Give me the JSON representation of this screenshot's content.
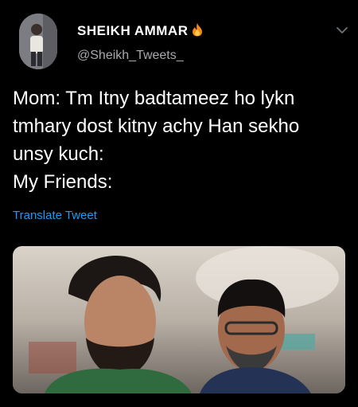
{
  "tweet": {
    "display_name": "SHEIKH AMMAR",
    "handle": "@Sheikh_Tweets_",
    "text_lines": [
      "Mom: Tm Itny badtameez ho lykn",
      "tmhary dost kitny achy Han sekho",
      "unsy kuch:",
      "My Friends:"
    ],
    "translate_label": "Translate Tweet"
  },
  "icons": {
    "name_emoji": "fire-icon",
    "menu": "chevron-down-icon"
  },
  "colors": {
    "background": "#000000",
    "text": "#ffffff",
    "handle": "#a8a8ad",
    "link": "#1d9bf0"
  }
}
